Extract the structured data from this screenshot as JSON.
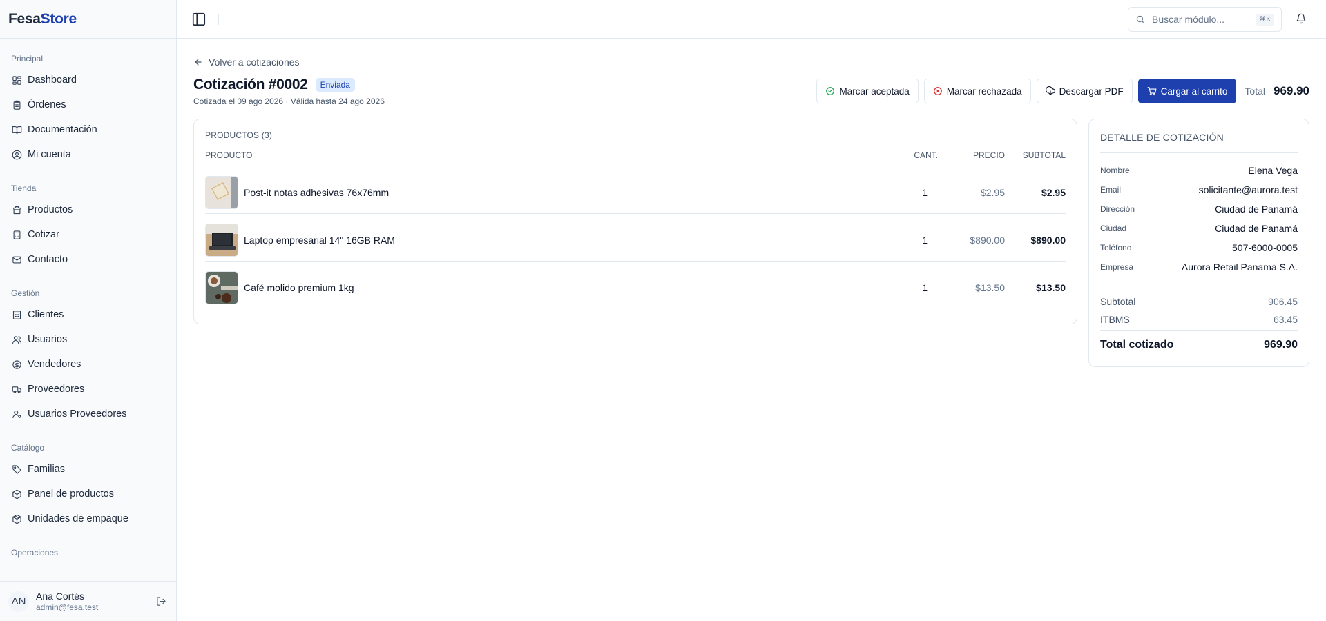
{
  "brand": {
    "part1": "Fesa",
    "part2": "Store"
  },
  "sidebar": {
    "groups": [
      {
        "title": "Principal",
        "items": [
          {
            "label": "Dashboard",
            "icon": "dashboard-icon"
          },
          {
            "label": "Órdenes",
            "icon": "clipboard-icon"
          },
          {
            "label": "Documentación",
            "icon": "book-icon"
          },
          {
            "label": "Mi cuenta",
            "icon": "user-circle-icon"
          }
        ]
      },
      {
        "title": "Tienda",
        "items": [
          {
            "label": "Productos",
            "icon": "store-icon"
          },
          {
            "label": "Cotizar",
            "icon": "calculator-icon"
          },
          {
            "label": "Contacto",
            "icon": "mail-icon"
          }
        ]
      },
      {
        "title": "Gestión",
        "items": [
          {
            "label": "Clientes",
            "icon": "building-icon"
          },
          {
            "label": "Usuarios",
            "icon": "users-icon"
          },
          {
            "label": "Vendedores",
            "icon": "coin-icon"
          },
          {
            "label": "Proveedores",
            "icon": "truck-icon"
          },
          {
            "label": "Usuarios Proveedores",
            "icon": "user-cog-icon"
          }
        ]
      },
      {
        "title": "Catálogo",
        "items": [
          {
            "label": "Familias",
            "icon": "tag-icon"
          },
          {
            "label": "Panel de productos",
            "icon": "box-icon"
          },
          {
            "label": "Unidades de empaque",
            "icon": "package-icon"
          }
        ]
      },
      {
        "title": "Operaciones",
        "items": []
      }
    ],
    "user": {
      "initials": "AN",
      "name": "Ana Cortés",
      "email": "admin@fesa.test"
    }
  },
  "topbar": {
    "search_placeholder": "Buscar módulo...",
    "shortcut": "⌘K"
  },
  "quote": {
    "back_label": "Volver a cotizaciones",
    "title": "Cotización #0002",
    "status": "Enviada",
    "subtitle": "Cotizada el 09 ago 2026 · Válida hasta 24 ago 2026",
    "actions": {
      "accept": "Marcar aceptada",
      "reject": "Marcar rechazada",
      "pdf": "Descargar PDF",
      "cart": "Cargar al carrito"
    },
    "total_label": "Total",
    "total_value": "969.90"
  },
  "products": {
    "heading": "PRODUCTOS (3)",
    "columns": {
      "product": "PRODUCTO",
      "qty": "CANT.",
      "price": "PRECIO",
      "subtotal": "SUBTOTAL"
    },
    "rows": [
      {
        "name": "Post-it notas adhesivas 76x76mm",
        "qty": "1",
        "price": "$2.95",
        "subtotal": "$2.95"
      },
      {
        "name": "Laptop empresarial 14\" 16GB RAM",
        "qty": "1",
        "price": "$890.00",
        "subtotal": "$890.00"
      },
      {
        "name": "Café molido premium 1kg",
        "qty": "1",
        "price": "$13.50",
        "subtotal": "$13.50"
      }
    ]
  },
  "detail": {
    "title": "DETALLE DE COTIZACIÓN",
    "fields": [
      {
        "label": "Nombre",
        "value": "Elena Vega"
      },
      {
        "label": "Email",
        "value": "solicitante@aurora.test"
      },
      {
        "label": "Dirección",
        "value": "Ciudad de Panamá"
      },
      {
        "label": "Ciudad",
        "value": "Ciudad de Panamá"
      },
      {
        "label": "Teléfono",
        "value": "507-6000-0005"
      },
      {
        "label": "Empresa",
        "value": "Aurora Retail Panamá S.A."
      }
    ],
    "subtotal_label": "Subtotal",
    "subtotal_value": "906.45",
    "tax_label": "ITBMS",
    "tax_value": "63.45",
    "grand_label": "Total cotizado",
    "grand_value": "969.90"
  },
  "colors": {
    "accent": "#1e40af",
    "badge_bg": "#dbeafe",
    "accept_icon": "#16a34a",
    "reject_icon": "#dc2626"
  }
}
